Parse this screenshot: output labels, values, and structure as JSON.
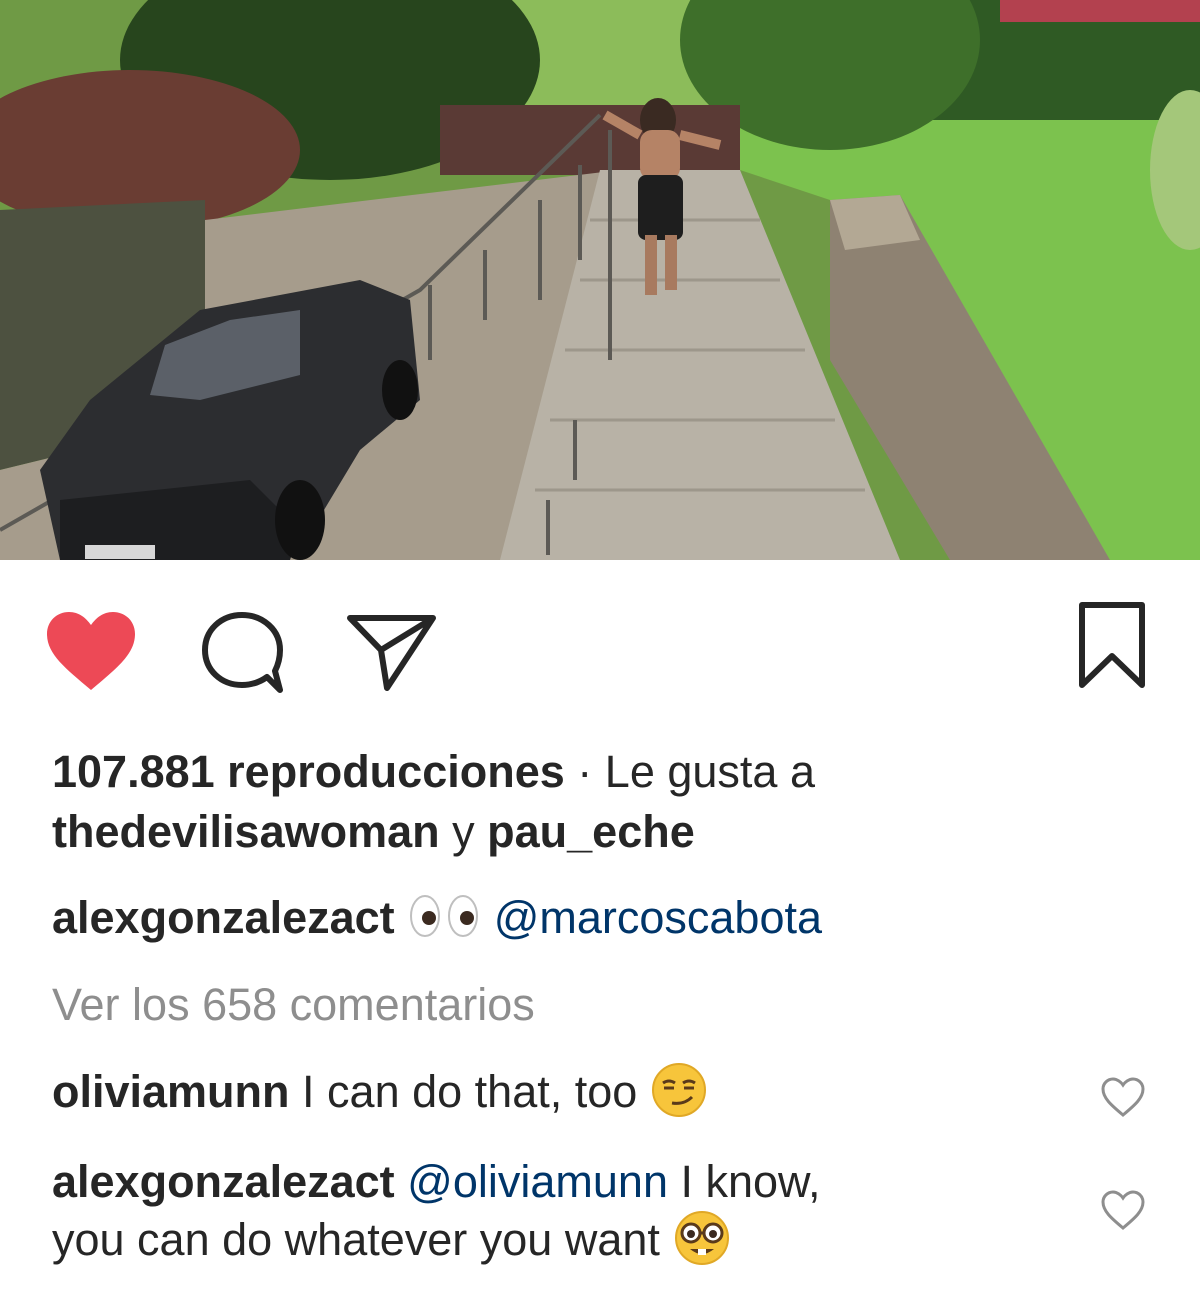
{
  "post": {
    "views_count": "107.881 reproducciones",
    "separator": "·",
    "liked_by_prefix": "Le gusta a",
    "liked_user_1": "thedevilisawoman",
    "liked_joiner": "y",
    "liked_user_2": "pau_eche"
  },
  "caption": {
    "author": "alexgonzalezact",
    "emoji": "eyes-emoji",
    "mention": "@marcoscabota"
  },
  "view_all_comments": "Ver los 658 comentarios",
  "comments": [
    {
      "author": "oliviamunn",
      "text": "I can do that, too",
      "emoji": "smirking-face-emoji"
    },
    {
      "author": "alexgonzalezact",
      "mention": "@oliviamunn",
      "text_1": "I know,",
      "text_2": "you can do whatever you want",
      "emoji": "nerd-face-emoji"
    }
  ],
  "colors": {
    "like_red": "#ed4956",
    "text": "#262626",
    "muted": "#8e8e8e",
    "link": "#003569"
  },
  "icons": [
    "heart-filled-icon",
    "comment-icon",
    "share-icon",
    "bookmark-icon",
    "heart-outline-icon"
  ]
}
